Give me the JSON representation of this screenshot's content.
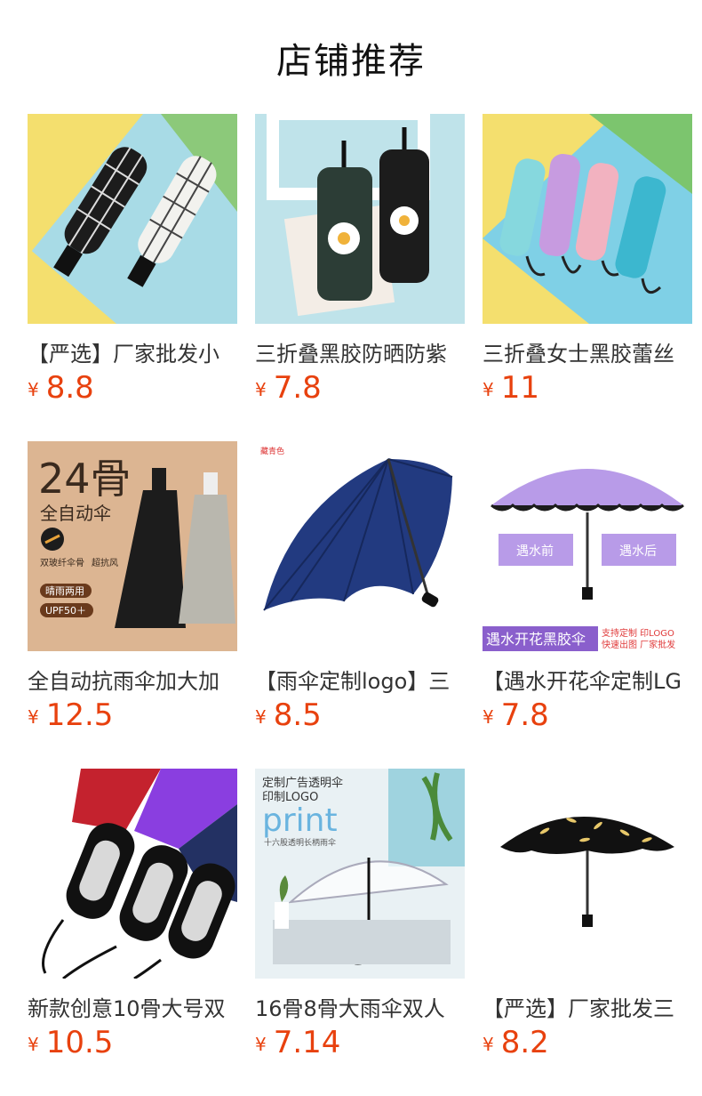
{
  "page": {
    "title": "店铺推荐"
  },
  "theme": {
    "price_color": "#e8410e"
  },
  "products": [
    {
      "name": "【严选】厂家批发小",
      "currency": "¥",
      "price": "8.8",
      "image": "checkered-folding-umbrellas-photo"
    },
    {
      "name": "三折叠黑胶防晒防紫",
      "currency": "¥",
      "price": "7.8",
      "image": "daisy-print-umbrellas-photo"
    },
    {
      "name": "三折叠女士黑胶蕾丝",
      "currency": "¥",
      "price": "11",
      "image": "floral-lace-umbrellas-photo"
    },
    {
      "name": "全自动抗雨伞加大加",
      "currency": "¥",
      "price": "12.5",
      "image": "auto-umbrella-ad-photo",
      "image_text": {
        "big": "24骨",
        "sub": "全自动伞",
        "tag1": "双玻纤伞骨",
        "tag2": "超抗风",
        "badge1": "晴雨两用",
        "badge2": "UPF50＋"
      }
    },
    {
      "name": "【雨伞定制logo】三",
      "currency": "¥",
      "price": "8.5",
      "image": "navy-open-umbrella-photo",
      "image_text": {
        "corner": "藏青色"
      }
    },
    {
      "name": "【遇水开花伞定制LG",
      "currency": "¥",
      "price": "7.8",
      "image": "purple-flower-umbrella-photo",
      "image_text": {
        "before": "遇水前",
        "after": "遇水后",
        "bar": "遇水开花黑胶伞",
        "note1": "支持定制 印LOGO",
        "note2": "快速出图 厂家批发"
      }
    },
    {
      "name": "新款创意10骨大号双",
      "currency": "¥",
      "price": "10.5",
      "image": "auto-umbrella-handles-photo"
    },
    {
      "name": "16骨8骨大雨伞双人",
      "currency": "¥",
      "price": "7.14",
      "image": "clear-umbrella-ad-photo",
      "image_text": {
        "line1": "定制广告透明伞",
        "line2": "印制LOGO",
        "big": "print",
        "sub": "十六股透明长柄雨伞"
      }
    },
    {
      "name": "【严选】厂家批发三",
      "currency": "¥",
      "price": "8.2",
      "image": "black-feather-umbrella-photo"
    }
  ]
}
